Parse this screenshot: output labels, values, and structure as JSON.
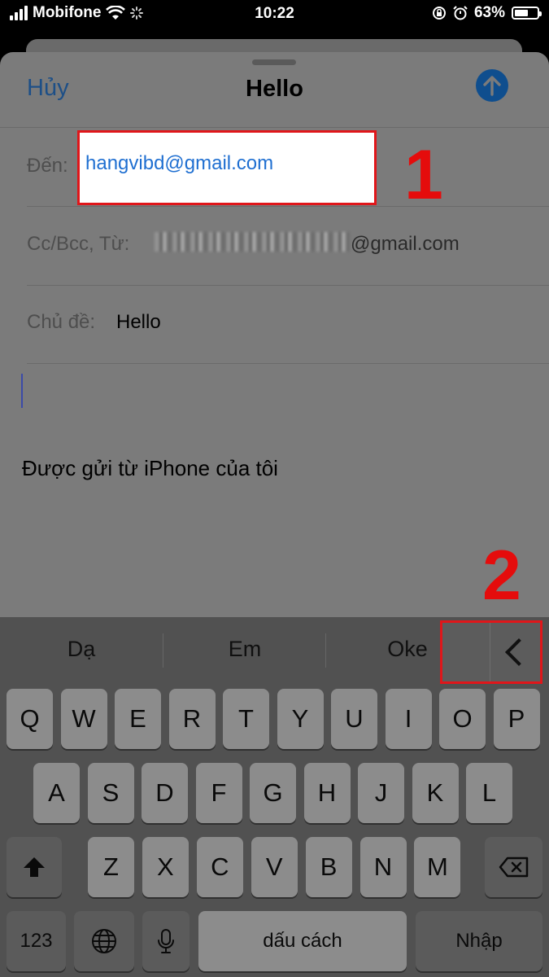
{
  "status_bar": {
    "carrier": "Mobifone",
    "time": "10:22",
    "battery_percent": 63,
    "battery_label": "63%"
  },
  "compose": {
    "cancel_label": "Hủy",
    "title": "Hello",
    "to_label": "Đến:",
    "to_value": "hangvibd@gmail.com",
    "cc_label": "Cc/Bcc, Từ:",
    "from_domain": "@gmail.com",
    "subject_label": "Chủ đề:",
    "subject_value": "Hello",
    "signature": "Được gửi từ iPhone của tôi"
  },
  "annotations": {
    "marker_1": "1",
    "marker_2": "2"
  },
  "keyboard": {
    "suggestions": [
      "Dạ",
      "Em",
      "Oke"
    ],
    "row1": [
      "Q",
      "W",
      "E",
      "R",
      "T",
      "Y",
      "U",
      "I",
      "O",
      "P"
    ],
    "row2": [
      "A",
      "S",
      "D",
      "F",
      "G",
      "H",
      "J",
      "K",
      "L"
    ],
    "row3": [
      "Z",
      "X",
      "C",
      "V",
      "B",
      "N",
      "M"
    ],
    "numbers_label": "123",
    "space_label": "dấu cách",
    "return_label": "Nhập"
  },
  "colors": {
    "accent": "#1f6fd1",
    "highlight": "#e0161a",
    "send": "#0f4e8e"
  }
}
